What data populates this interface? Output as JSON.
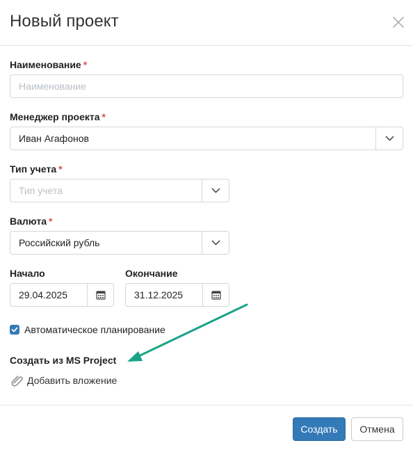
{
  "dialog": {
    "title": "Новый проект"
  },
  "form": {
    "name": {
      "label": "Наименование",
      "required_mark": "*",
      "placeholder": "Наименование",
      "value": ""
    },
    "manager": {
      "label": "Менеджер проекта",
      "required_mark": "*",
      "value": "Иван Агафонов"
    },
    "accounting_type": {
      "label": "Тип учета",
      "required_mark": "*",
      "placeholder": "Тип учета"
    },
    "currency": {
      "label": "Валюта",
      "required_mark": "*",
      "value": "Российский рубль"
    },
    "start": {
      "label": "Начало",
      "value": "29.04.2025"
    },
    "end": {
      "label": "Окончание",
      "value": "31.12.2025"
    },
    "auto_planning": {
      "label": "Автоматическое планирование",
      "checked": true
    },
    "ms_project": {
      "title": "Создать из MS Project",
      "attach_label": "Добавить вложение"
    }
  },
  "footer": {
    "create_label": "Создать",
    "cancel_label": "Отмена"
  },
  "colors": {
    "primary": "#337ab7",
    "required": "#d9534f",
    "annotation_arrow": "#1aa386"
  },
  "icons": [
    "close-icon",
    "chevron-down-icon",
    "calendar-icon",
    "checkmark-icon",
    "paperclip-icon",
    "annotation-arrow"
  ]
}
